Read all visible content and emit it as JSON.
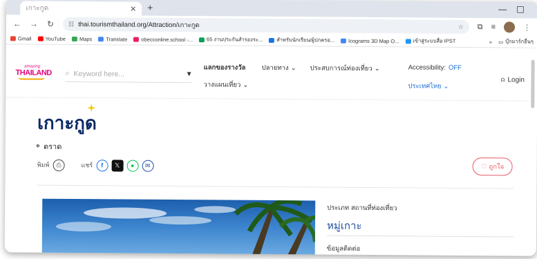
{
  "browser": {
    "tab_title": "เกาะกูด",
    "url": "thai.tourismthailand.org/Attraction/เกาะกูด",
    "bookmarks": [
      {
        "label": "Gmail",
        "color": "#ea4335"
      },
      {
        "label": "YouTube",
        "color": "#ff0000"
      },
      {
        "label": "Maps",
        "color": "#34a853"
      },
      {
        "label": "Translate",
        "color": "#4285f4"
      },
      {
        "label": "obecconline.school -...",
        "color": "#e91e63"
      },
      {
        "label": "65 งานประกันสำรองระ...",
        "color": "#0f9d58"
      },
      {
        "label": "สำหรับนักเรียน/ผู้ปกครอ...",
        "color": "#1a73e8"
      },
      {
        "label": "Icograms 3D Map O...",
        "color": "#4285f4"
      },
      {
        "label": "เข้าสู่ระบบสื่อ IPST",
        "color": "#2196f3"
      }
    ],
    "bookmarks_more": "»",
    "bookmark_folder": "บุ๊กมาร์กอื่นๆ"
  },
  "site": {
    "logo_small": "amazing",
    "logo_main": "THAILAND",
    "search_placeholder": "Keyword here...",
    "menu": {
      "rewards": "แลกของรางวัล",
      "destinations": "ปลายทาง",
      "experiences": "ประสบการณ์ท่องเที่ยว",
      "trip_plan": "วางแผนเที่ยว"
    },
    "accessibility_label": "Accessibility:",
    "accessibility_value": "OFF",
    "language": "ประเทศไทย",
    "login": "Login"
  },
  "attraction": {
    "title": "เกาะกูด",
    "province": "ตราด",
    "print_label": "พิมพ์",
    "share_label": "แชร์",
    "like_label": "ถูกใจ",
    "type_label": "ประเภท สถานที่ท่องเที่ยว",
    "type_value": "หมู่เกาะ",
    "contact_label": "ข้อมูลติดต่อ"
  },
  "colors": {
    "brand_pink": "#e3007b",
    "title_navy": "#0b2a66",
    "link_blue": "#1e6fd9",
    "like_red": "#e75a64"
  }
}
